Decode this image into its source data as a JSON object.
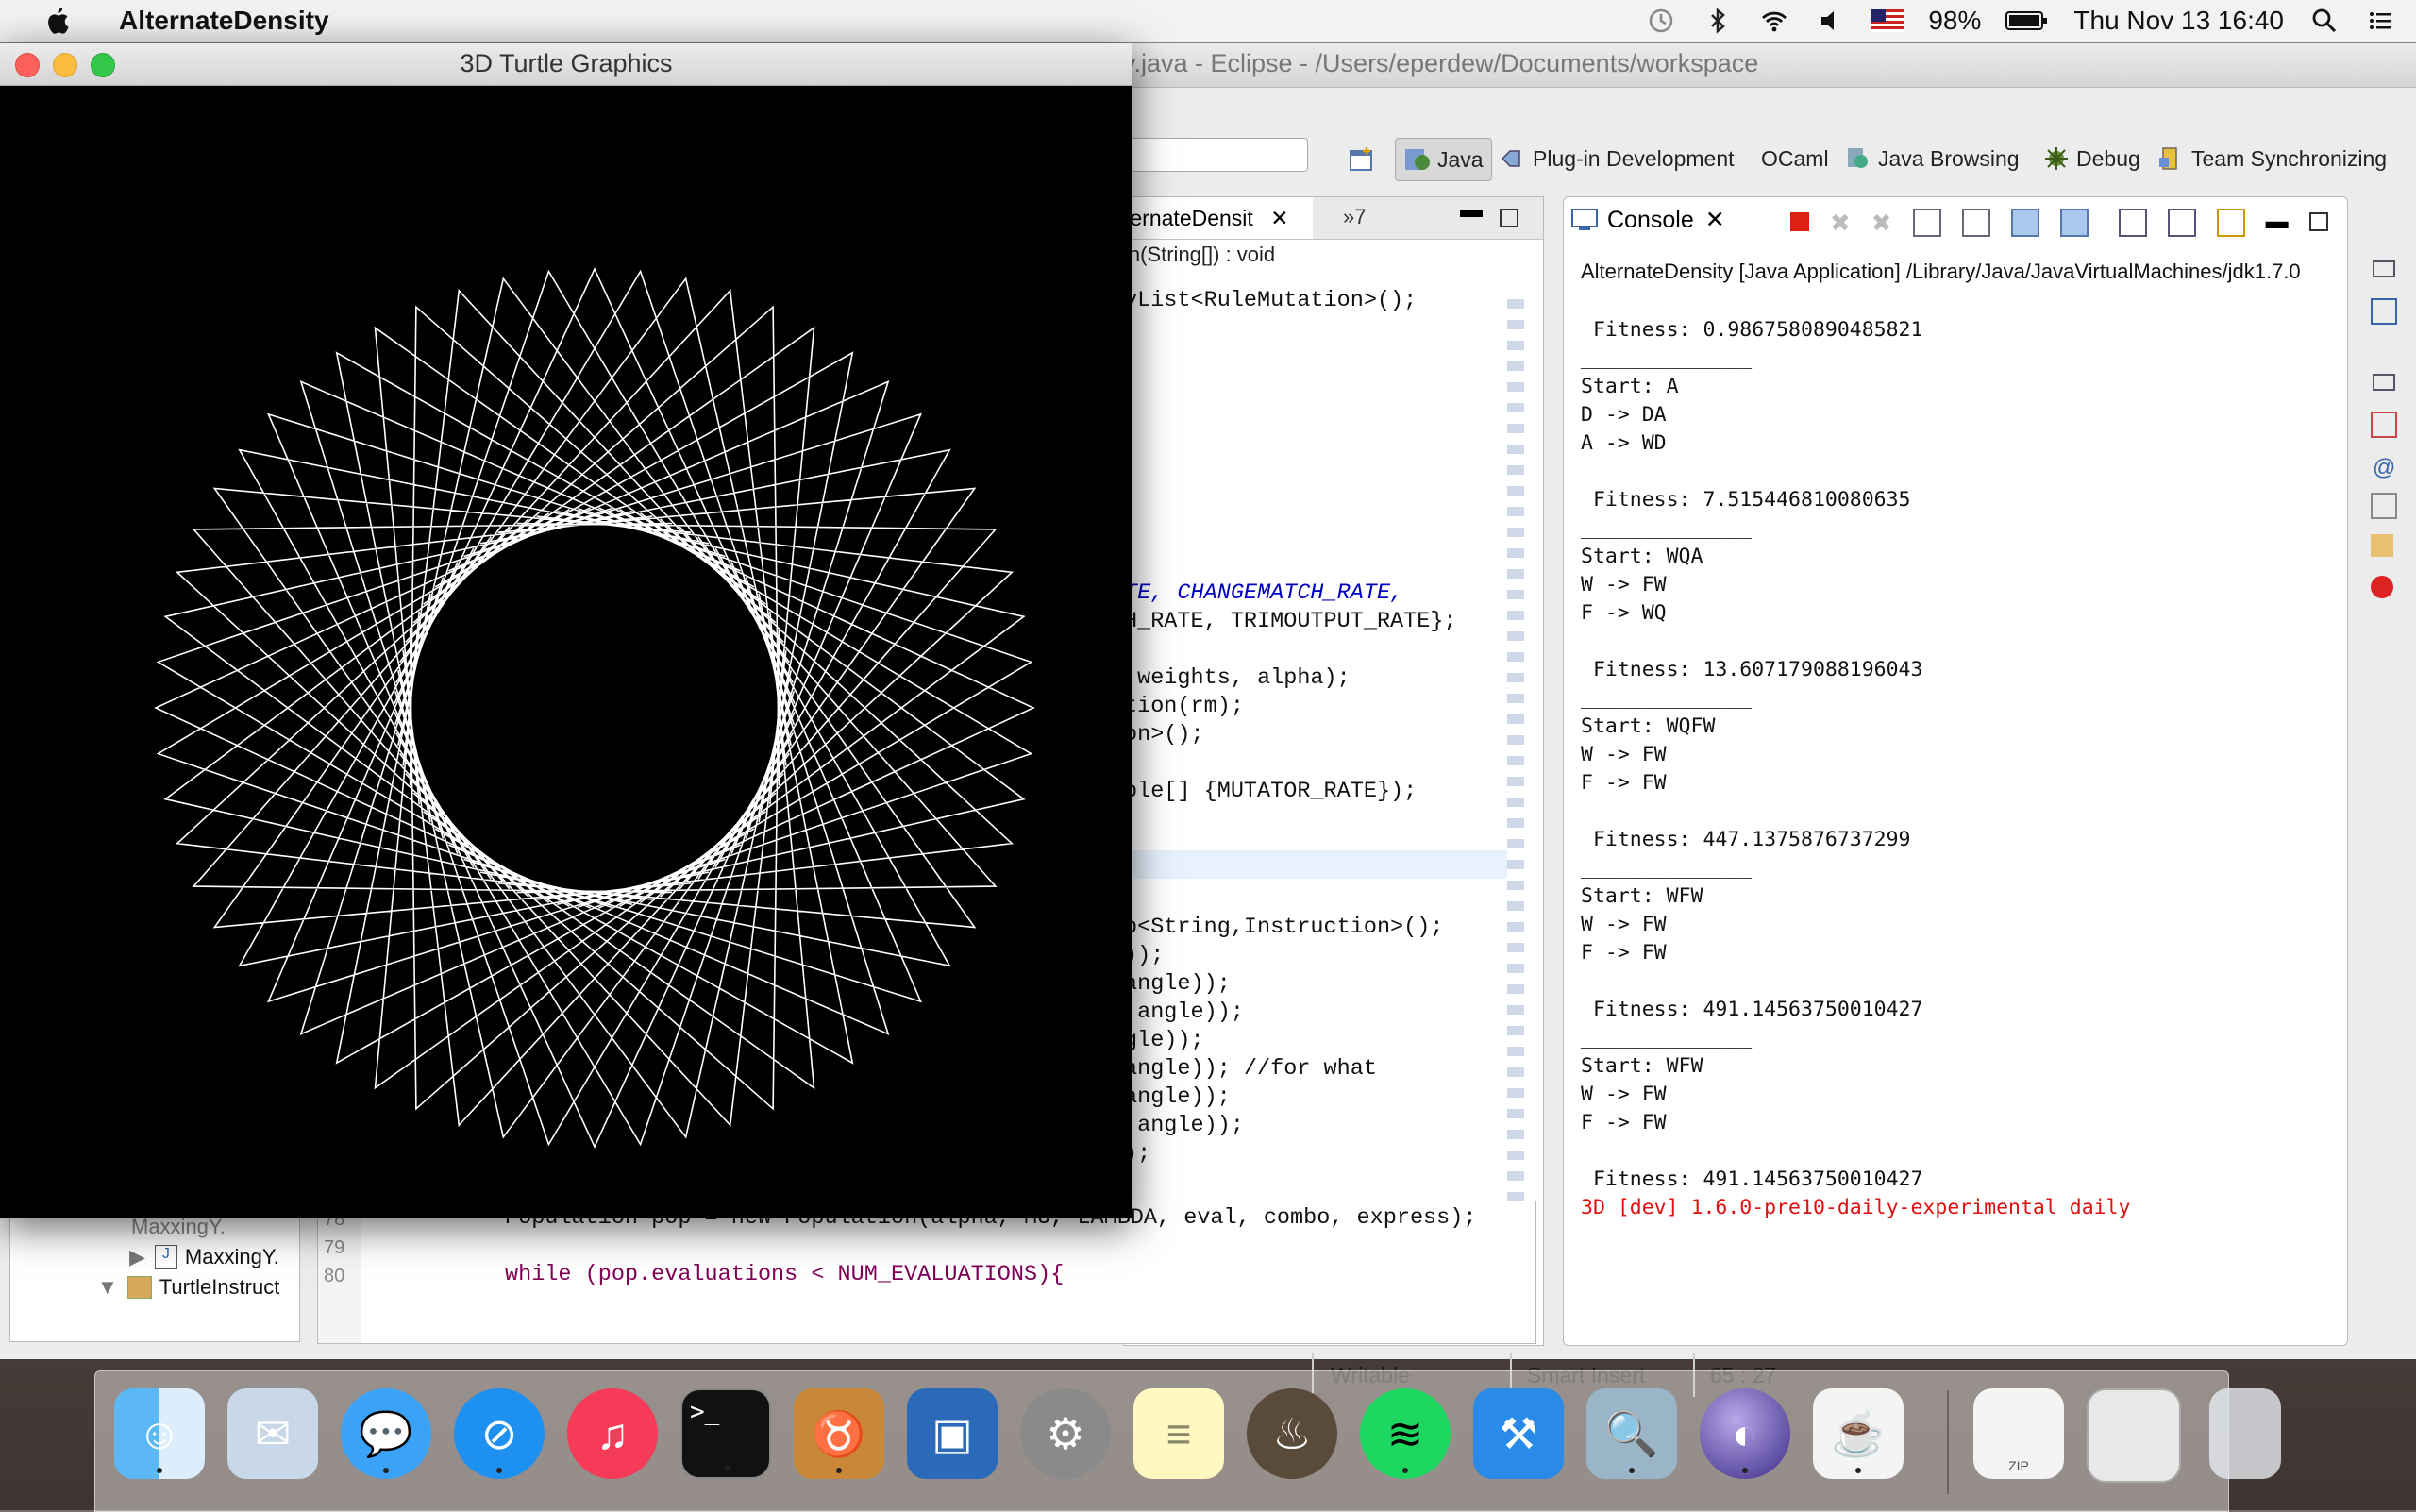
{
  "menubar": {
    "app_name": "AlternateDensity",
    "battery": "98%",
    "clock": "Thu Nov 13  16:40"
  },
  "eclipse": {
    "window_title": "y.java - Eclipse - /Users/eperdew/Documents/workspace",
    "perspectives": [
      "Java",
      "Plug-in Development",
      "OCaml",
      "Java Browsing",
      "Debug",
      "Team Synchronizing"
    ],
    "editor": {
      "tab_label": "ternateDensit",
      "overflow_label": "»7",
      "breadcrumb": "in(String[]) : void",
      "lines": [
        {
          "text": "yList<RuleMutation>();"
        },
        {
          "text": "TE, CHANGEMATCH_RATE,"
        },
        {
          "text": "H_RATE, TRIMOUTPUT_RATE};"
        },
        {
          "text": " weights, alpha);"
        },
        {
          "text": "tion(rm);"
        },
        {
          "text": "on>();"
        },
        {
          "text": "ble[] {MUTATOR_RATE});"
        },
        {
          "text": "p<String,Instruction>();"
        },
        {
          "text": "));"
        },
        {
          "text": "angle));"
        },
        {
          "text": ",angle));"
        },
        {
          "text": "gle));"
        },
        {
          "text": "angle)); //for what"
        },
        {
          "text": "angle));"
        },
        {
          "text": ",angle));"
        },
        {
          "text": ");"
        }
      ],
      "line_numbers": [
        "78",
        "79",
        "80"
      ],
      "line78": "Population pop = new Population(alpha, MU, LAMBDA, eval, combo, express);",
      "line80": "while (pop.evaluations < NUM_EVALUATIONS){"
    },
    "console": {
      "tab_label": "Console",
      "path": "AlternateDensity [Java Application] /Library/Java/JavaVirtualMachines/jdk1.7.0",
      "output": " Fitness: 0.9867580890485821\n______________\nStart: A\nD -> DA\nA -> WD\n\n Fitness: 7.515446810080635\n______________\nStart: WQA\nW -> FW\nF -> WQ\n\n Fitness: 13.607179088196043\n______________\nStart: WQFW\nW -> FW\nF -> FW\n\n Fitness: 447.1375876737299\n______________\nStart: WFW\nW -> FW\nF -> FW\n\n Fitness: 491.14563750010427\n______________\nStart: WFW\nW -> FW\nF -> FW\n\n Fitness: 491.14563750010427",
      "error_line": "3D [dev] 1.6.0-pre10-daily-experimental daily"
    },
    "explorer": {
      "items": [
        "MaxxingY.",
        "TurtleInstruct"
      ]
    },
    "status": {
      "writable": "Writable",
      "insert_mode": "Smart Insert",
      "position": "65 : 27"
    }
  },
  "turtle_window": {
    "title": "3D Turtle Graphics"
  },
  "dock": {
    "apps": [
      "finder-icon",
      "mail-icon",
      "messages-icon",
      "safari-icon",
      "itunes-icon",
      "terminal-icon",
      "gnu-icon",
      "virtualbox-icon",
      "system-preferences-icon",
      "notes-icon",
      "cauldron-icon",
      "spotify-icon",
      "xcode-icon",
      "preview-icon",
      "eclipse-icon",
      "java-icon",
      "zip-icon",
      "screenshot-icon",
      "trash-icon"
    ],
    "zip_label": "ZIP"
  },
  "colors": {
    "console_error": "#e01010",
    "keyword": "#7f0055",
    "constant": "#0000c0",
    "comment": "#3f7f5f"
  }
}
